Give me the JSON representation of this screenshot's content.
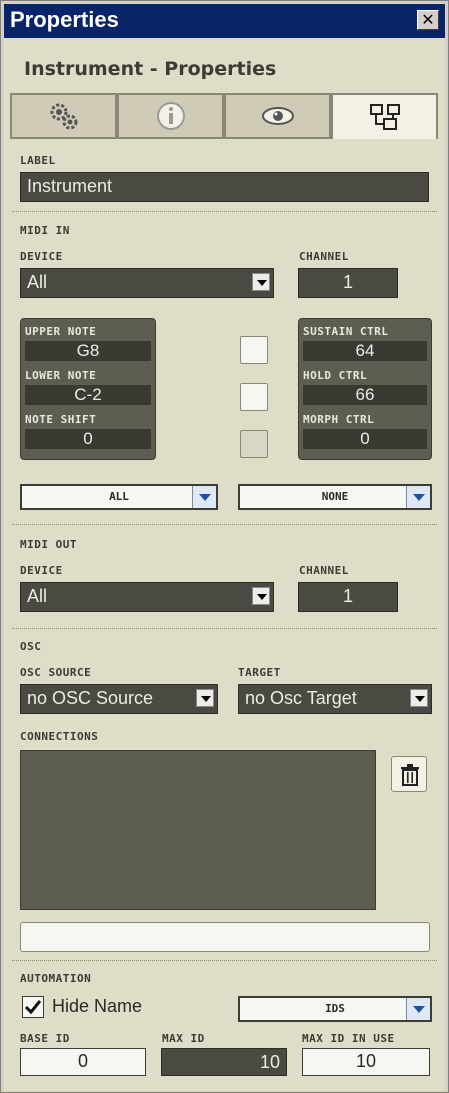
{
  "window": {
    "title": "Properties",
    "close_glyph": "✕"
  },
  "header": {
    "title": "Instrument - Properties"
  },
  "tabs": [
    {
      "name": "settings",
      "icon": "gears-icon"
    },
    {
      "name": "info",
      "icon": "info-icon"
    },
    {
      "name": "visibility",
      "icon": "eye-icon"
    },
    {
      "name": "connection",
      "icon": "connection-icon",
      "active": true
    }
  ],
  "label_section": {
    "heading": "LABEL",
    "value": "Instrument"
  },
  "midi_in": {
    "heading": "MIDI IN",
    "device_label": "DEVICE",
    "device_value": "All",
    "channel_label": "CHANNEL",
    "channel_value": "1",
    "upper_note_label": "UPPER NOTE",
    "upper_note_value": "G8",
    "lower_note_label": "LOWER NOTE",
    "lower_note_value": "C-2",
    "note_shift_label": "NOTE SHIFT",
    "note_shift_value": "0",
    "sustain_ctrl_label": "SUSTAIN CTRL",
    "sustain_ctrl_value": "64",
    "hold_ctrl_label": "HOLD CTRL",
    "hold_ctrl_value": "66",
    "morph_ctrl_label": "MORPH CTRL",
    "morph_ctrl_value": "0",
    "left_dropdown": "ALL",
    "right_dropdown": "NONE"
  },
  "midi_out": {
    "heading": "MIDI OUT",
    "device_label": "DEVICE",
    "device_value": "All",
    "channel_label": "CHANNEL",
    "channel_value": "1"
  },
  "osc": {
    "heading": "OSC",
    "source_label": "OSC SOURCE",
    "source_value": "no OSC Source",
    "target_label": "TARGET",
    "target_value": "no Osc Target",
    "connections_label": "CONNECTIONS",
    "connection_input_value": ""
  },
  "automation": {
    "heading": "AUTOMATION",
    "hide_name_label": "Hide Name",
    "hide_name_checked": true,
    "ids_dropdown": "IDS",
    "base_id_label": "BASE ID",
    "base_id_value": "0",
    "max_id_label": "MAX ID",
    "max_id_value": "10",
    "max_id_in_use_label": "MAX ID IN USE",
    "max_id_in_use_value": "10"
  },
  "colors": {
    "titlebar": "#0a246a",
    "panel": "#dfdcc8",
    "dark_field": "#4a4a42",
    "accent_arrow": "#2050a0"
  }
}
